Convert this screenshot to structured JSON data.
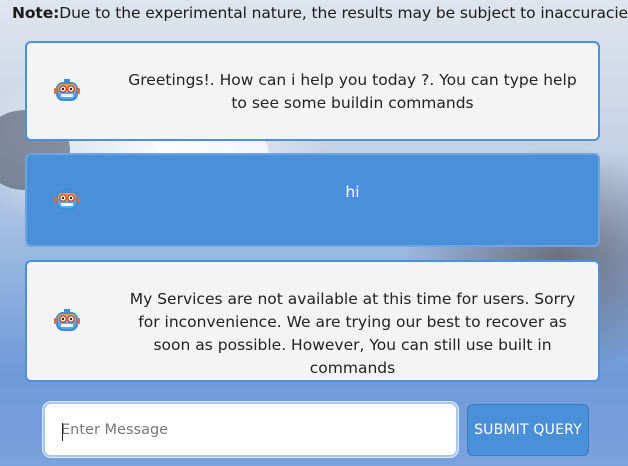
{
  "note": {
    "label": "Note:",
    "text": "Due to the experimental nature, the results may be subject to inaccuracies"
  },
  "messages": [
    {
      "sender": "bot",
      "avatar_icon": "robot-icon",
      "text": "Greetings!. How can i help you today ?. You can type help to see some buildin commands"
    },
    {
      "sender": "user",
      "avatar_icon": "robot-icon",
      "text": "hi"
    },
    {
      "sender": "bot",
      "avatar_icon": "robot-icon",
      "text": "My Services are not available at this time for users. Sorry for inconvenience. We are trying our best to recover as soon as possible. However, You can still use built in commands"
    }
  ],
  "composer": {
    "placeholder": "Enter Message",
    "value": "",
    "submit_label": "SUBMIT QUERY"
  },
  "colors": {
    "accent": "#4a90d9",
    "bot_bubble": "#f4f4f4",
    "user_bubble": "#4a90d9"
  }
}
